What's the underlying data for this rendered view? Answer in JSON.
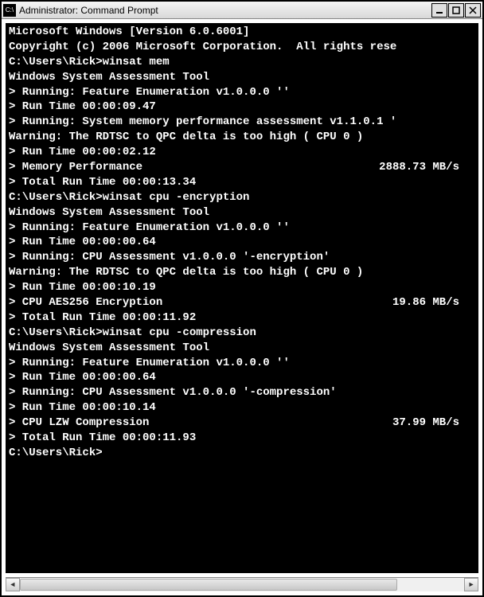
{
  "window": {
    "title": "Administrator: Command Prompt"
  },
  "header": {
    "line1": "Microsoft Windows [Version 6.0.6001]",
    "line2": "Copyright (c) 2006 Microsoft Corporation.  All rights rese"
  },
  "blocks": [
    {
      "prompt": "C:\\Users\\Rick>",
      "command": "winsat mem",
      "tool_line": "Windows System Assessment Tool",
      "lines": [
        {
          "text": "> Running: Feature Enumeration v1.0.0.0 ''"
        },
        {
          "text": "> Run Time 00:00:09.47"
        },
        {
          "text": "> Running: System memory performance assessment v1.1.0.1 '"
        },
        {
          "text": "Warning: The RDTSC to QPC delta is too high ( CPU 0 )"
        },
        {
          "text": "> Run Time 00:00:02.12"
        },
        {
          "left": "> Memory Performance",
          "right": "2888.73 MB/s"
        },
        {
          "text": "> Total Run Time 00:00:13.34"
        }
      ]
    },
    {
      "prompt": "C:\\Users\\Rick>",
      "command": "winsat cpu -encryption",
      "tool_line": "Windows System Assessment Tool",
      "lines": [
        {
          "text": "> Running: Feature Enumeration v1.0.0.0 ''"
        },
        {
          "text": "> Run Time 00:00:00.64"
        },
        {
          "text": "> Running: CPU Assessment v1.0.0.0 '-encryption'"
        },
        {
          "text": "Warning: The RDTSC to QPC delta is too high ( CPU 0 )"
        },
        {
          "text": "> Run Time 00:00:10.19"
        },
        {
          "left": "> CPU AES256 Encryption",
          "right": "19.86 MB/s"
        },
        {
          "text": "> Total Run Time 00:00:11.92"
        }
      ]
    },
    {
      "prompt": "C:\\Users\\Rick>",
      "command": "winsat cpu -compression",
      "tool_line": "Windows System Assessment Tool",
      "lines": [
        {
          "text": "> Running: Feature Enumeration v1.0.0.0 ''"
        },
        {
          "text": "> Run Time 00:00:00.64"
        },
        {
          "text": "> Running: CPU Assessment v1.0.0.0 '-compression'"
        },
        {
          "text": "> Run Time 00:00:10.14"
        },
        {
          "left": "> CPU LZW Compression",
          "right": "37.99 MB/s"
        },
        {
          "text": "> Total Run Time 00:00:11.93"
        }
      ]
    }
  ],
  "final_prompt": "C:\\Users\\Rick>"
}
